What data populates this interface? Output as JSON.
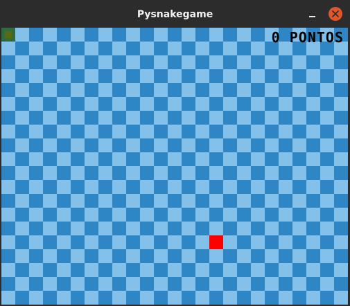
{
  "window": {
    "title": "Pysnakegame"
  },
  "game": {
    "score_label": "0 PONTOS",
    "colors": {
      "tile_dark": "#2f86c4",
      "tile_light": "#83c0ea",
      "food": "#ff0000",
      "snake": "#2f6b3e",
      "score_text": "#000000"
    }
  },
  "icons": {
    "minimize": "minimize-icon",
    "close": "close-icon"
  }
}
